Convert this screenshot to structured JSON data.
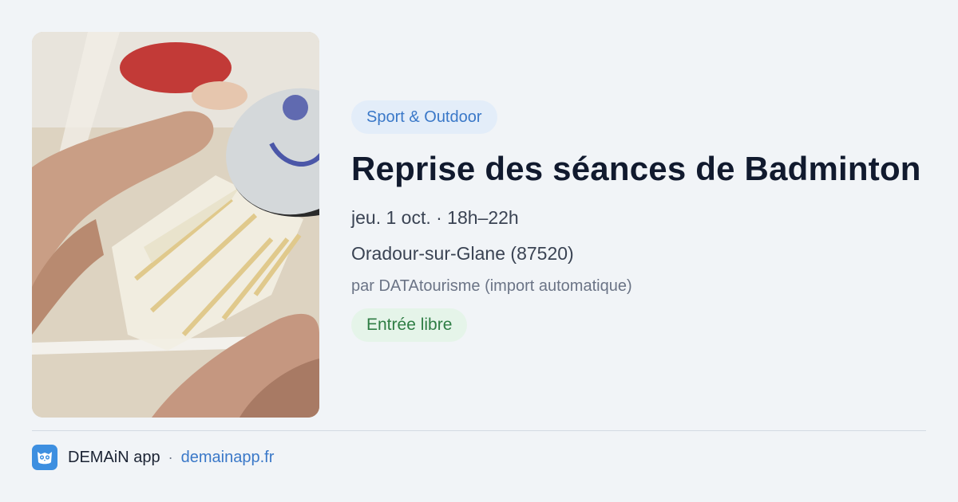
{
  "event": {
    "category": "Sport & Outdoor",
    "title": "Reprise des séances de Badminton",
    "datetime": "jeu. 1 oct. · 18h–22h",
    "location": "Oradour-sur-Glane (87520)",
    "source": "par DATAtourisme (import automatique)",
    "price": "Entrée libre",
    "image_icon": "badminton-shuttlecock-photo"
  },
  "footer": {
    "app_name": "DEMAiN app",
    "separator": "·",
    "url": "demainapp.fr",
    "logo_icon": "owl-logo-icon"
  },
  "colors": {
    "category_bg": "#e3edf9",
    "category_text": "#3a78c8",
    "price_bg": "#e5f4e9",
    "price_text": "#2e7d44",
    "link": "#3a78c8",
    "logo_bg": "#3d8fe0"
  }
}
